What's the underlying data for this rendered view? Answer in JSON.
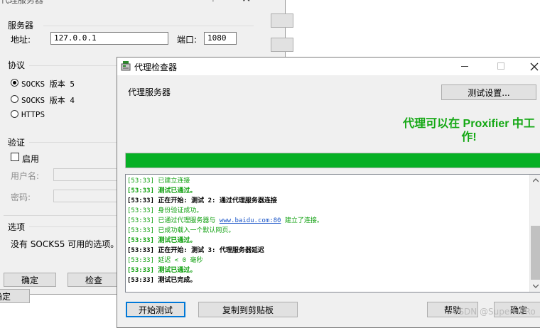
{
  "back_dialog": {
    "title": "代理服务器",
    "help_glyph": "?",
    "server_group": "服务器",
    "address_label": "地址:",
    "address_value": "127.0.0.1",
    "port_label": "端口:",
    "port_value": "1080",
    "protocol_group": "协议",
    "protocols": [
      "SOCKS 版本 5",
      "SOCKS 版本 4",
      "HTTPS"
    ],
    "auth_group": "验证",
    "enable_label": "启用",
    "username_label": "用户名:",
    "password_label": "密码:",
    "options_group": "选项",
    "options_text": "没有 SOCKS5 可用的选项。",
    "ok_button": "确定",
    "check_button": "检查",
    "bottom_fragment": "确定"
  },
  "checker_dialog": {
    "title": "代理检查器",
    "proxy_label": "代理服务器",
    "test_settings_button": "测试设置...",
    "status_line1": "代理可以在 Proxifier 中工",
    "status_line2": "作!",
    "progress": 1.0,
    "log": [
      {
        "text": "[53:33] 已建立连接",
        "color": "#10a010",
        "bold": false
      },
      {
        "text": "[53:33] 测试已通过。",
        "color": "#10a010",
        "bold": true
      },
      {
        "text": "[53:33] 正在开始: 测试 2: 通过代理服务器连接",
        "color": "#000000",
        "bold": true
      },
      {
        "text": "[53:33] 身份验证成功。",
        "color": "#10a010",
        "bold": false
      },
      {
        "text": "[53:33] 已通过代理服务器与 ",
        "link": "www.baidu.com:80",
        "suffix": " 建立了连接。",
        "color": "#10a010",
        "bold": false
      },
      {
        "text": "[53:33] 已成功载入一个默认网页。",
        "color": "#10a010",
        "bold": false
      },
      {
        "text": "[53:33] 测试已通过。",
        "color": "#10a010",
        "bold": true
      },
      {
        "text": "[53:33] 正在开始: 测试 3: 代理服务器延迟",
        "color": "#000000",
        "bold": true
      },
      {
        "text": "[53:33] 延迟 < 0 毫秒",
        "color": "#10a010",
        "bold": false
      },
      {
        "text": "[53:33] 测试已通过。",
        "color": "#10a010",
        "bold": true
      },
      {
        "text": "[53:33] 测试已完成。",
        "color": "#000000",
        "bold": true
      }
    ],
    "start_test_button": "开始测试",
    "copy_button": "复制到剪贴板",
    "help_button": "帮助",
    "ok_button": "确定",
    "watermark": "CSDN @SuperHeRo"
  },
  "colors": {
    "status_green": "#14a814",
    "progress_green": "#06b025",
    "focus_blue": "#0078d7",
    "link_blue": "#1a55c8"
  }
}
